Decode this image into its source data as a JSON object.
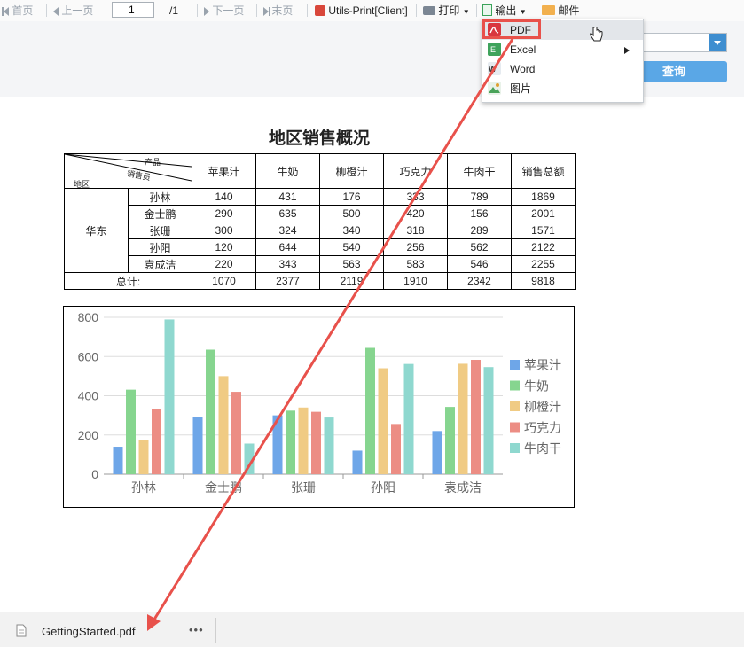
{
  "toolbar": {
    "first": "首页",
    "prev": "上一页",
    "page_value": "1",
    "page_total": "/1",
    "next": "下一页",
    "last": "末页",
    "print_client": "Utils-Print[Client]",
    "print": "打印",
    "export": "输出",
    "mail": "邮件"
  },
  "panel": {
    "query_button": "查询"
  },
  "export_menu": {
    "items": [
      {
        "label": "PDF",
        "icon": "pdf-icon",
        "highlighted": true
      },
      {
        "label": "Excel",
        "icon": "excel-icon",
        "has_submenu": true
      },
      {
        "label": "Word",
        "icon": "word-icon"
      },
      {
        "label": "图片",
        "icon": "image-icon"
      }
    ]
  },
  "report": {
    "title": "地区销售概况",
    "header_diag": {
      "product": "产品",
      "salesperson": "销售员",
      "region": "地区"
    },
    "columns": [
      "苹果汁",
      "牛奶",
      "柳橙汁",
      "巧克力",
      "牛肉干",
      "销售总额"
    ],
    "region": "华东",
    "rows": [
      {
        "name": "孙林",
        "values": [
          "140",
          "431",
          "176",
          "333",
          "789",
          "1869"
        ]
      },
      {
        "name": "金士鹏",
        "values": [
          "290",
          "635",
          "500",
          "420",
          "156",
          "2001"
        ]
      },
      {
        "name": "张珊",
        "values": [
          "300",
          "324",
          "340",
          "318",
          "289",
          "1571"
        ]
      },
      {
        "name": "孙阳",
        "values": [
          "120",
          "644",
          "540",
          "256",
          "562",
          "2122"
        ]
      },
      {
        "name": "袁成洁",
        "values": [
          "220",
          "343",
          "563",
          "583",
          "546",
          "2255"
        ]
      }
    ],
    "total_label": "总计:",
    "totals": [
      "1070",
      "2377",
      "2119",
      "1910",
      "2342",
      "9818"
    ]
  },
  "chart_data": {
    "type": "bar",
    "categories": [
      "孙林",
      "金士鹏",
      "张珊",
      "孙阳",
      "袁成洁"
    ],
    "series": [
      {
        "name": "苹果汁",
        "color": "#6ea6e8",
        "values": [
          140,
          290,
          300,
          120,
          220
        ]
      },
      {
        "name": "牛奶",
        "color": "#86d58f",
        "values": [
          431,
          635,
          324,
          644,
          343
        ]
      },
      {
        "name": "柳橙汁",
        "color": "#f0cb84",
        "values": [
          176,
          500,
          340,
          540,
          563
        ]
      },
      {
        "name": "巧克力",
        "color": "#ec8d84",
        "values": [
          333,
          420,
          318,
          256,
          583
        ]
      },
      {
        "name": "牛肉干",
        "color": "#8fd8cf",
        "values": [
          789,
          156,
          289,
          562,
          546
        ]
      }
    ],
    "yticks": [
      0,
      200,
      400,
      600,
      800
    ],
    "ylim": [
      0,
      800
    ],
    "grid": true,
    "legend": "right"
  },
  "download_bar": {
    "filename": "GettingStarted.pdf",
    "more": "•••"
  },
  "colors": {
    "annotation_red": "#e8514b",
    "accent_blue": "#3e8ed0"
  }
}
